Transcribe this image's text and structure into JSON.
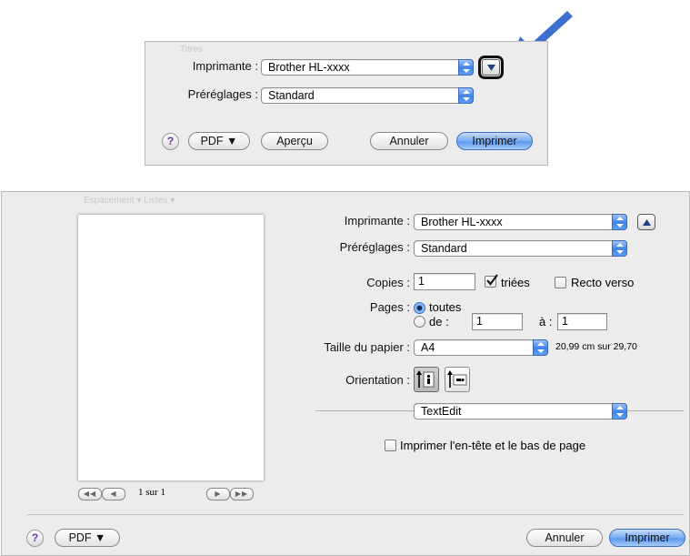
{
  "colors": {
    "arrow": "#3d6fd0",
    "accent": "#5a9aef",
    "panel": "#ececec"
  },
  "small_dialog": {
    "ghost_toolbar": "Titres",
    "printer_label": "Imprimante :",
    "printer_value": "Brother HL-xxxx",
    "presets_label": "Préréglages :",
    "presets_value": "Standard",
    "help_glyph": "?",
    "pdf_button": "PDF ▼",
    "preview_button": "Aperçu",
    "cancel_button": "Annuler",
    "print_button": "Imprimer",
    "expand_icon": "disclosure-down-icon"
  },
  "large_dialog": {
    "ghost_toolbar": "Espacement ▾   Listes ▾",
    "printer_label": "Imprimante :",
    "printer_value": "Brother HL-xxxx",
    "presets_label": "Préréglages :",
    "presets_value": "Standard",
    "copies_label": "Copies :",
    "copies_value": "1",
    "collated_label": "triées",
    "collated_checked": true,
    "duplex_label": "Recto verso",
    "duplex_checked": false,
    "pages_label": "Pages :",
    "pages_all_label": "toutes",
    "pages_from_label": "de :",
    "pages_from_value": "1",
    "pages_to_label": "à :",
    "pages_to_value": "1",
    "paper_size_label": "Taille du papier :",
    "paper_size_value": "A4",
    "paper_size_dims": "20,99 cm sur 29,70",
    "orientation_label": "Orientation :",
    "section_value": "TextEdit",
    "header_footer_label": "Imprimer l'en-tête et le bas de page",
    "header_footer_checked": false,
    "page_counter": "1 sur 1",
    "nav_first": "◀◀",
    "nav_prev": "◀",
    "nav_next": "▶",
    "nav_last": "▶▶",
    "help_glyph": "?",
    "pdf_button": "PDF ▼",
    "cancel_button": "Annuler",
    "print_button": "Imprimer",
    "collapse_icon": "disclosure-up-icon"
  }
}
